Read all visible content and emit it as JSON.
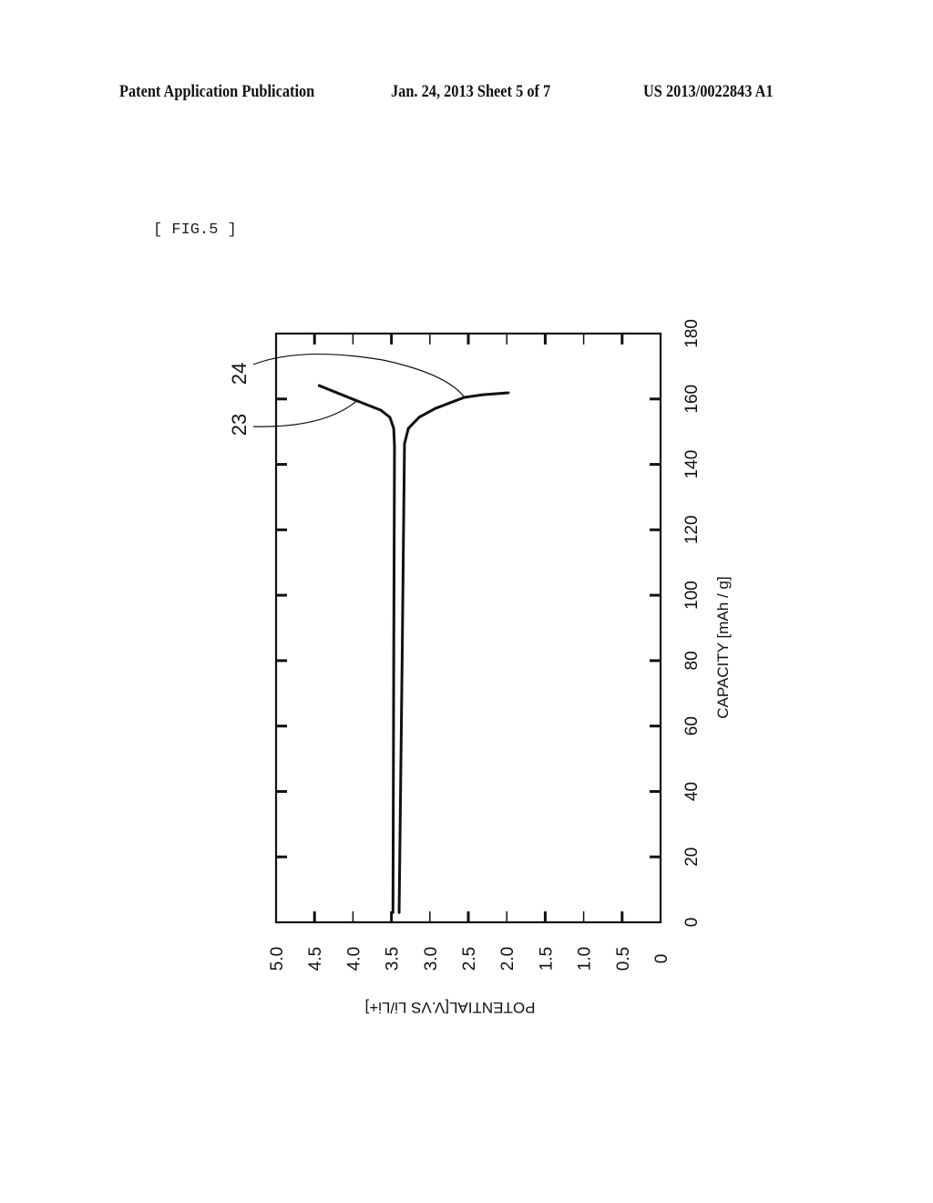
{
  "header": {
    "publication": "Patent Application Publication",
    "date_sheet": "Jan. 24, 2013   Sheet 5 of 7",
    "patent_number": "US 2013/0022843 A1"
  },
  "figure_label": "[ FIG.5 ]",
  "chart_data": {
    "type": "line",
    "orientation": "rotated-90",
    "title": "",
    "xlabel": "POTENTIAL[V.VS Li/Li+]",
    "ylabel": "CAPACITY [mAh / g]",
    "xlim": [
      5.0,
      0
    ],
    "ylim": [
      0,
      180
    ],
    "x_ticks": [
      "5.0",
      "4.5",
      "4.0",
      "3.5",
      "3.0",
      "2.5",
      "2.0",
      "1.5",
      "1.0",
      "0.5",
      "0"
    ],
    "y_ticks": [
      "0",
      "20",
      "40",
      "60",
      "80",
      "100",
      "120",
      "140",
      "160",
      "180"
    ],
    "grid": false,
    "legend": "none",
    "series": [
      {
        "name": "23",
        "points": [
          [
            3.48,
            3
          ],
          [
            3.47,
            80
          ],
          [
            3.46,
            145.4
          ],
          [
            3.47,
            151.0
          ],
          [
            3.52,
            154.4
          ],
          [
            3.64,
            156.6
          ],
          [
            4.03,
            160.2
          ],
          [
            4.44,
            164.1
          ]
        ]
      },
      {
        "name": "24",
        "points": [
          [
            3.4,
            3
          ],
          [
            3.36,
            81.4
          ],
          [
            3.33,
            146.3
          ],
          [
            3.28,
            151.0
          ],
          [
            3.14,
            154.4
          ],
          [
            2.93,
            157.1
          ],
          [
            2.55,
            160.5
          ],
          [
            2.31,
            161.3
          ],
          [
            1.98,
            161.9
          ]
        ]
      }
    ],
    "annotations": [
      {
        "text": "24",
        "target_series": "24",
        "target_point": [
          2.55,
          160.5
        ]
      },
      {
        "text": "23",
        "target_series": "23",
        "target_point": [
          3.95,
          159.4
        ]
      }
    ]
  }
}
